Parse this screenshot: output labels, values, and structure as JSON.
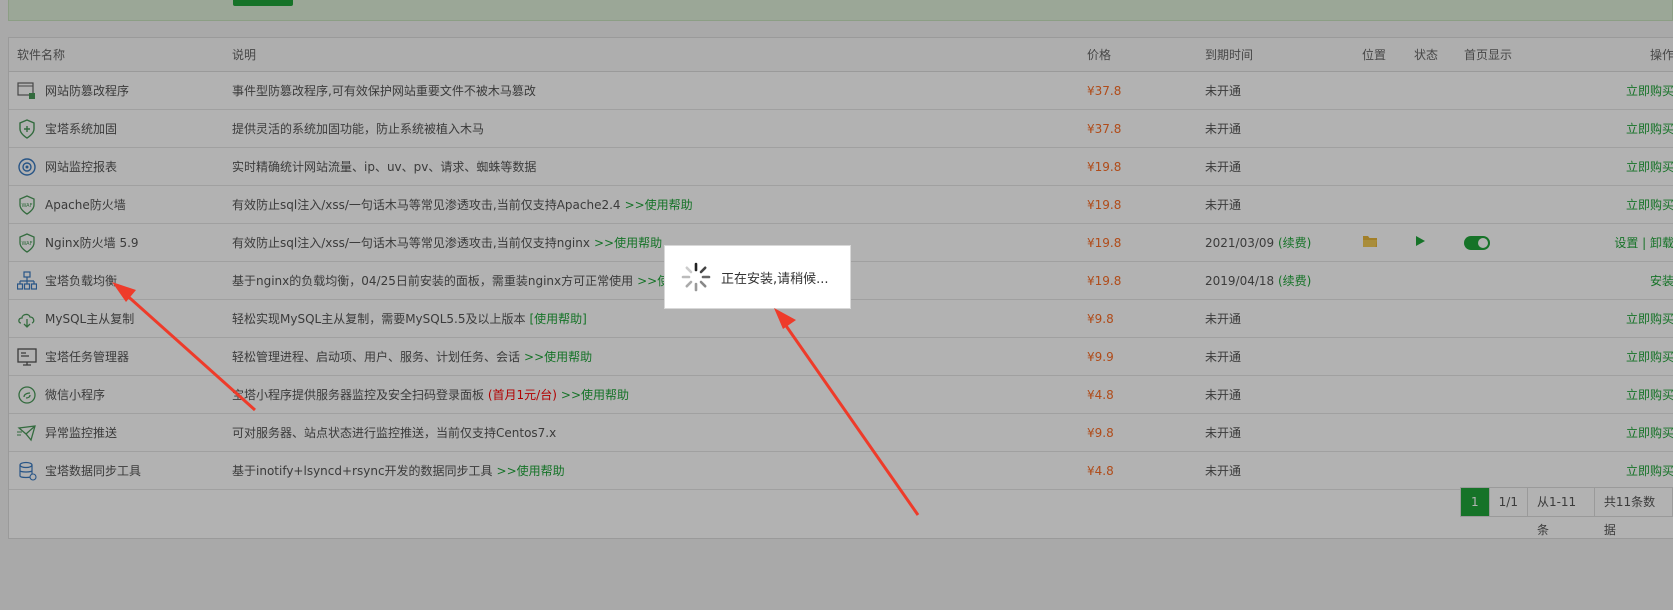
{
  "notice": {
    "text": "",
    "button": ""
  },
  "headers": {
    "name": "软件名称",
    "desc": "说明",
    "price": "价格",
    "expire": "到期时间",
    "location": "位置",
    "status": "状态",
    "home": "首页显示",
    "ops": "操作"
  },
  "rows": [
    {
      "icon": "tamper-proof-icon",
      "name": "网站防篡改程序",
      "desc": "事件型防篡改程序,可有效保护网站重要文件不被木马篡改",
      "help": "",
      "price": "¥37.8",
      "expire": "未开通",
      "renew": "",
      "op": "立即购买"
    },
    {
      "icon": "shield-plus-icon",
      "name": "宝塔系统加固",
      "desc": "提供灵活的系统加固功能，防止系统被植入木马",
      "help": "",
      "price": "¥37.8",
      "expire": "未开通",
      "renew": "",
      "op": "立即购买"
    },
    {
      "icon": "monitor-target-icon",
      "name": "网站监控报表",
      "desc": "实时精确统计网站流量、ip、uv、pv、请求、蜘蛛等数据",
      "help": "",
      "price": "¥19.8",
      "expire": "未开通",
      "renew": "",
      "op": "立即购买"
    },
    {
      "icon": "waf-shield-icon",
      "name": "Apache防火墙",
      "desc": "有效防止sql注入/xss/一句话木马等常见渗透攻击,当前仅支持Apache2.4",
      "help": ">>使用帮助",
      "price": "¥19.8",
      "expire": "未开通",
      "renew": "",
      "op": "立即购买"
    },
    {
      "icon": "waf-shield-icon",
      "name": "Nginx防火墙 5.9",
      "desc": "有效防止sql注入/xss/一句话木马等常见渗透攻击,当前仅支持nginx",
      "help": ">>使用帮助",
      "price": "¥19.8",
      "expire": "2021/03/09",
      "renew": "(续费)",
      "op": "设置 | 卸载"
    },
    {
      "icon": "load-balance-icon",
      "name": "宝塔负载均衡",
      "desc": "基于nginx的负载均衡，04/25日前安装的面板，需重装nginx方可正常使用",
      "help": ">>使用帮助",
      "price": "¥19.8",
      "expire": "2019/04/18",
      "renew": "(续费)",
      "op": "安装"
    },
    {
      "icon": "mysql-sync-icon",
      "name": "MySQL主从复制",
      "desc": "轻松实现MySQL主从复制，需要MySQL5.5及以上版本",
      "help": "[使用帮助]",
      "price": "¥9.8",
      "expire": "未开通",
      "renew": "",
      "op": "立即购买"
    },
    {
      "icon": "task-manager-icon",
      "name": "宝塔任务管理器",
      "desc": "轻松管理进程、启动项、用户、服务、计划任务、会话",
      "help": ">>使用帮助",
      "price": "¥9.9",
      "expire": "未开通",
      "renew": "",
      "op": "立即购买"
    },
    {
      "icon": "wechat-mini-icon",
      "name": "微信小程序",
      "desc": "宝塔小程序提供服务器监控及安全扫码登录面板",
      "red": "(首月1元/台)",
      "help": ">>使用帮助",
      "price": "¥4.8",
      "expire": "未开通",
      "renew": "",
      "op": "立即购买"
    },
    {
      "icon": "alert-push-icon",
      "name": "异常监控推送",
      "desc": "可对服务器、站点状态进行监控推送，当前仅支持Centos7.x",
      "help": "",
      "price": "¥9.8",
      "expire": "未开通",
      "renew": "",
      "op": "立即购买"
    },
    {
      "icon": "data-sync-icon",
      "name": "宝塔数据同步工具",
      "desc": "基于inotify+lsyncd+rsync开发的数据同步工具",
      "help": ">>使用帮助",
      "price": "¥4.8",
      "expire": "未开通",
      "renew": "",
      "op": "立即购买"
    }
  ],
  "pager": {
    "current": "1",
    "pages": "1/1",
    "range": "从1-11条",
    "total": "共11条数据"
  },
  "modal": {
    "message": "正在安装,请稍候..."
  },
  "colors": {
    "accent": "#20a53a",
    "price": "#fc6d26",
    "overlay": "rgba(0,0,0,0.3)",
    "arrow": "#ee3b2a"
  }
}
